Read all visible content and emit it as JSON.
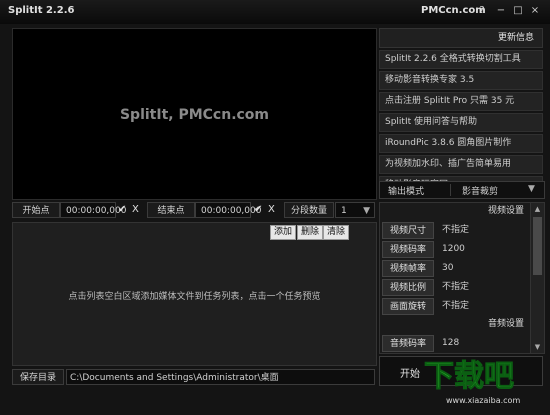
{
  "app": {
    "title": "SplitIt 2.2.6",
    "site": "PMCcn.com",
    "help_icon": "?",
    "minimize_icon": "−",
    "maximize_icon": "□",
    "close_icon": "×"
  },
  "video": {
    "overlay_text": "SplitIt, PMCcn.com"
  },
  "news": {
    "header": "更新信息",
    "items": [
      "SplitIt 2.2.6 全格式转换切割工具",
      "移动影音转换专家 3.5",
      "点击注册 SplitIt Pro 只需 35 元",
      "SplitIt 使用问答与帮助",
      "iRoundPic 3.8.6 圆角图片制作",
      "为视频加水印、插广告简单易用",
      "移动影音玩家网"
    ]
  },
  "output_mode": {
    "label": "输出模式",
    "value": "影音裁剪",
    "arrow": "▼"
  },
  "controls": {
    "start_label": "开始点",
    "start_time": "00:00:00,000",
    "end_label": "结束点",
    "end_time": "00:00:00,000",
    "check_icon": "✔",
    "clear_icon": "X",
    "segment_label": "分段数量",
    "segment_value": "1",
    "segment_arrow": "▼"
  },
  "list": {
    "add_label": "添加",
    "delete_label": "删除",
    "clear_label": "清除",
    "hint": "点击列表空白区域添加媒体文件到任务列表，点击一个任务预览"
  },
  "settings": {
    "video_header": "视频设置",
    "video_rows": [
      {
        "label": "视频尺寸",
        "value": "不指定"
      },
      {
        "label": "视频码率",
        "value": "1200"
      },
      {
        "label": "视频帧率",
        "value": "30"
      },
      {
        "label": "视频比例",
        "value": "不指定"
      },
      {
        "label": "画面旋转",
        "value": "不指定"
      }
    ],
    "audio_header": "音频设置",
    "audio_rows": [
      {
        "label": "音频码率",
        "value": "128"
      }
    ]
  },
  "output": {
    "save_label": "保存目录",
    "save_path": "C:\\Documents and Settings\\Administrator\\桌面",
    "start_button": "开始"
  },
  "watermark": {
    "text": "下载吧",
    "url": "www.xiazaiba.com"
  },
  "colors": {
    "background": "#141414",
    "accent": "#2dbb2d"
  }
}
